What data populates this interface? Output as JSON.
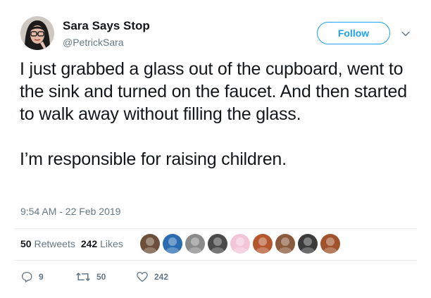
{
  "user": {
    "display_name": "Sara Says Stop",
    "handle": "@PetrickSara",
    "avatar_icon": "profile-photo"
  },
  "follow_button": {
    "label": "Follow"
  },
  "tweet": {
    "paragraphs": [
      "I just grabbed a glass out of the cupboard, went to the sink and turned on the faucet. And then started to walk away without filling the glass.",
      "I’m responsible for raising children."
    ],
    "timestamp": "9:54 AM - 22 Feb 2019"
  },
  "stats": {
    "retweets_count": "50",
    "retweets_label": "Retweets",
    "likes_count": "242",
    "likes_label": "Likes"
  },
  "liker_avatars": [
    {
      "icon": "liker-avatar-1",
      "color": "#6b4f3a"
    },
    {
      "icon": "liker-avatar-2",
      "color": "#2b6cb0"
    },
    {
      "icon": "liker-avatar-3",
      "color": "#8a8a8a"
    },
    {
      "icon": "liker-avatar-4",
      "color": "#4a4a4a"
    },
    {
      "icon": "liker-avatar-5",
      "color": "#f2c6d8"
    },
    {
      "icon": "liker-avatar-6",
      "color": "#b5562e"
    },
    {
      "icon": "liker-avatar-7",
      "color": "#8a5a3c"
    },
    {
      "icon": "liker-avatar-8",
      "color": "#3b3b3b"
    },
    {
      "icon": "liker-avatar-9",
      "color": "#a0522d"
    }
  ],
  "actions": {
    "reply_count": "9",
    "retweet_count": "50",
    "like_count": "242"
  },
  "colors": {
    "accent": "#1da1f2",
    "text": "#14171a",
    "secondary": "#657786",
    "border": "#e6ecf0"
  }
}
